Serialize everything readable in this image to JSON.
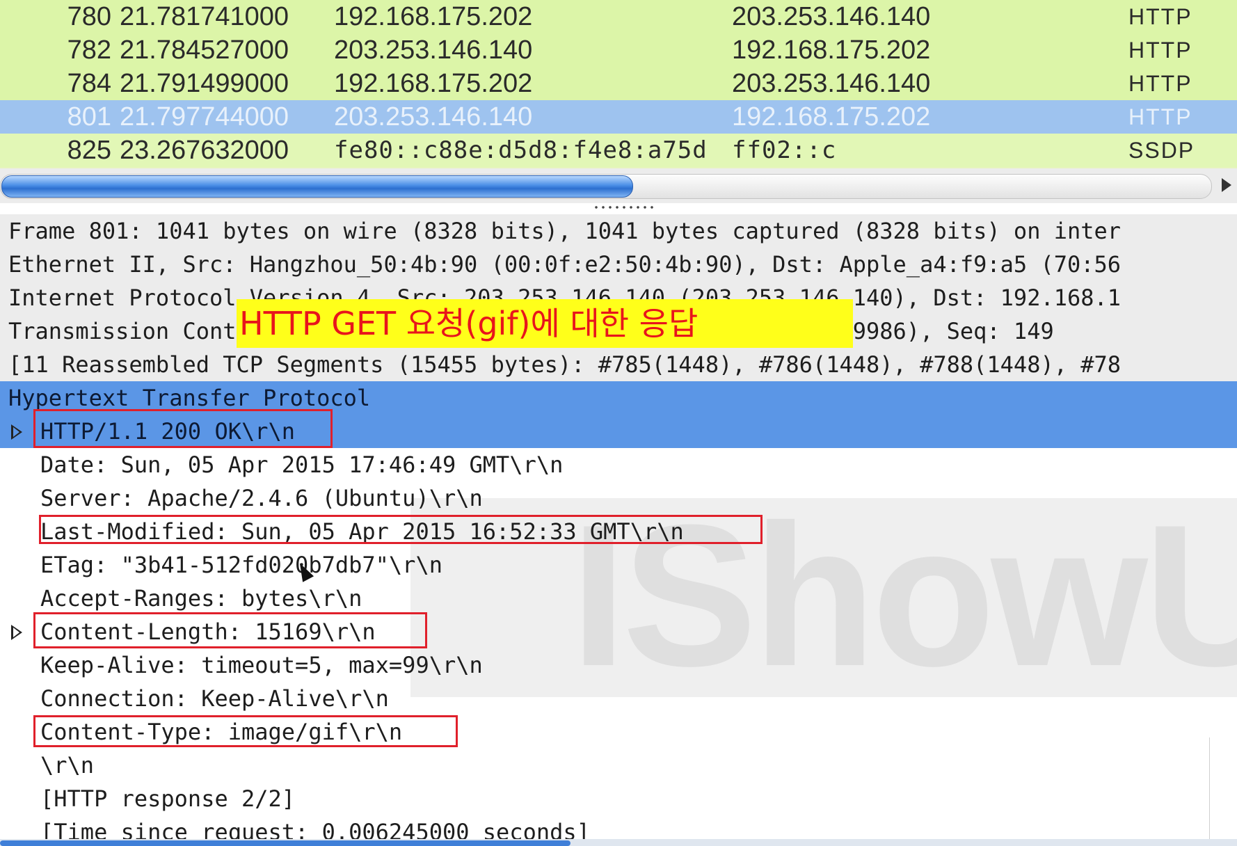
{
  "packet_list": {
    "rows": [
      {
        "no": "780",
        "time": "21.781741000",
        "source": "192.168.175.202",
        "destination": "203.253.146.140",
        "protocol": "HTTP",
        "selected": false
      },
      {
        "no": "782",
        "time": "21.784527000",
        "source": "203.253.146.140",
        "destination": "192.168.175.202",
        "protocol": "HTTP",
        "selected": false
      },
      {
        "no": "784",
        "time": "21.791499000",
        "source": "192.168.175.202",
        "destination": "203.253.146.140",
        "protocol": "HTTP",
        "selected": false
      },
      {
        "no": "801",
        "time": "21.797744000",
        "source": "203.253.146.140",
        "destination": "192.168.175.202",
        "protocol": "HTTP",
        "selected": true
      },
      {
        "no": "825",
        "time": "23.267632000",
        "source": "fe80::c88e:d5d8:f4e8:a75d",
        "destination": "ff02::c",
        "protocol": "SSDP",
        "selected": false
      }
    ]
  },
  "details": {
    "frame": "Frame 801: 1041 bytes on wire (8328 bits), 1041 bytes captured (8328 bits) on inter",
    "ethernet": "Ethernet II, Src: Hangzhou_50:4b:90 (00:0f:e2:50:4b:90), Dst: Apple_a4:f9:a5 (70:56",
    "ip": "Internet Protocol Version 4, Src: 203.253.146.140 (203.253.146.140), Dst: 192.168.1",
    "tcp": "Transmission Control Protocol, Src Port: 80, Dst Port: 49986 (49986), Seq: 149",
    "reassembled": "[11 Reassembled TCP Segments (15455 bytes): #785(1448), #786(1448), #788(1448), #78",
    "http_header": "Hypertext Transfer Protocol",
    "http_fields": [
      "HTTP/1.1 200 OK\\r\\n",
      "Date: Sun, 05 Apr 2015 17:46:49 GMT\\r\\n",
      "Server: Apache/2.4.6 (Ubuntu)\\r\\n",
      "Last-Modified: Sun, 05 Apr 2015 16:52:33 GMT\\r\\n",
      "ETag: \"3b41-512fd020b7db7\"\\r\\n",
      "Accept-Ranges: bytes\\r\\n",
      "Content-Length: 15169\\r\\n",
      "Keep-Alive: timeout=5, max=99\\r\\n",
      "Connection: Keep-Alive\\r\\n",
      "Content-Type: image/gif\\r\\n",
      "\\r\\n",
      "[HTTP response 2/2]",
      "[Time since request: 0.006245000 seconds]"
    ]
  },
  "annotation": {
    "text": "HTTP GET 요청(gif)에 대한 응답",
    "background": "#ffff1a",
    "color": "#e8141c"
  },
  "colors": {
    "http_row": "#dcf5a8",
    "selected_row": "#9ec3ef",
    "highlight_box": "#e0202b",
    "selected_tree": "#5b96e6"
  }
}
